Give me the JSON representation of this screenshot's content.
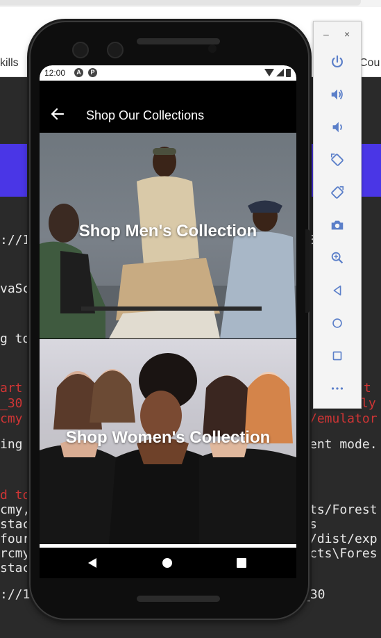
{
  "background": {
    "tab_left": "kills",
    "tab_right": "Cou",
    "terminal_left": [
      {
        "text": "://1",
        "color": "white",
        "row": 0
      },
      {
        "text": "vaSc",
        "color": "white",
        "row": 1
      },
      {
        "text": "g to",
        "color": "white",
        "row": 2
      },
      {
        "text": "art",
        "color": "red",
        "row": 3
      },
      {
        "text": "_30",
        "color": "red",
        "row": 4
      },
      {
        "text": "cmy",
        "color": "red",
        "row": 5
      },
      {
        "text": "ing",
        "color": "white",
        "row": 6
      },
      {
        "text": "d to",
        "color": "red",
        "row": 7
      },
      {
        "text": "cmy,",
        "color": "white",
        "row": 8
      },
      {
        "text": "stac",
        "color": "white",
        "row": 9
      },
      {
        "text": "four",
        "color": "white",
        "row": 10
      },
      {
        "text": "rcmy",
        "color": "white",
        "row": 11
      },
      {
        "text": "stac",
        "color": "white",
        "row": 12
      },
      {
        "text": "://1",
        "color": "white",
        "row": 13
      }
    ],
    "terminal_right": [
      {
        "text": "3",
        "color": "white",
        "row": 0
      },
      {
        "text": "t",
        "color": "red",
        "row": 3
      },
      {
        "text": "ly",
        "color": "red",
        "row": 4
      },
      {
        "text": "/emulator",
        "color": "red",
        "row": 5
      },
      {
        "text": "ent mode.",
        "color": "white",
        "row": 6
      },
      {
        "text": "ts/Forest",
        "color": "white",
        "row": 8
      },
      {
        "text": "s",
        "color": "white",
        "row": 9
      },
      {
        "text": "/dist/exp",
        "color": "white",
        "row": 10
      },
      {
        "text": "cts\\Fores",
        "color": "white",
        "row": 11
      },
      {
        "text": "_30",
        "color": "white",
        "row": 13
      }
    ]
  },
  "status_bar": {
    "time": "12:00",
    "icon_a": "A",
    "icon_p": "P"
  },
  "app_bar": {
    "title": "Shop Our Collections",
    "back_icon": "arrow-left-icon"
  },
  "collections": [
    {
      "label": "Shop Men's Collection"
    },
    {
      "label": "Shop Women's Collection"
    }
  ],
  "nav_bar": {
    "back_icon": "triangle-back-icon",
    "home_icon": "circle-home-icon",
    "recent_icon": "square-recents-icon"
  },
  "emulator_toolbar": {
    "minimize": "–",
    "close": "×",
    "buttons": [
      "power-icon",
      "volume-up-icon",
      "volume-down-icon",
      "rotate-left-icon",
      "rotate-right-icon",
      "camera-icon",
      "zoom-icon",
      "back-icon",
      "home-icon",
      "overview-icon",
      "more-icon"
    ]
  },
  "colors": {
    "accent_purple": "#4a36e6",
    "toolbar_icon": "#5b7fc9",
    "terminal_red": "#d03535"
  }
}
